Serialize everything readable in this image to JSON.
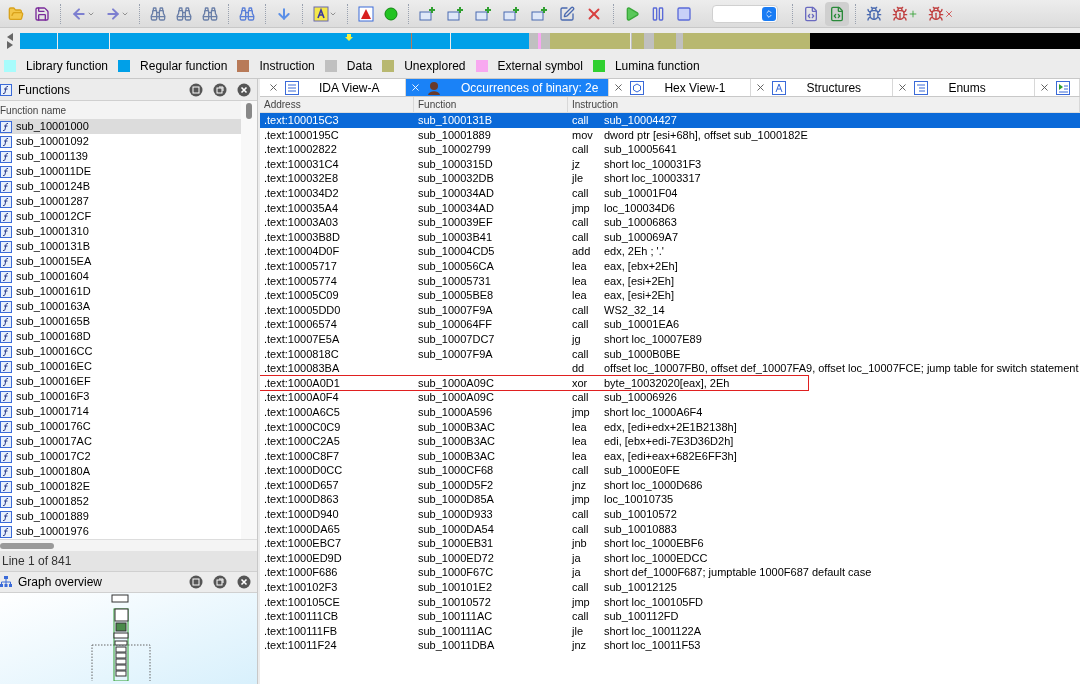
{
  "legend": [
    {
      "label": "Library function",
      "color": "#a8fcfc"
    },
    {
      "label": "Regular function",
      "color": "#00a0e8"
    },
    {
      "label": "Instruction",
      "color": "#b87a58"
    },
    {
      "label": "Data",
      "color": "#c0c0c0"
    },
    {
      "label": "Unexplored",
      "color": "#b8b870"
    },
    {
      "label": "External symbol",
      "color": "#f8a8f0"
    },
    {
      "label": "Lumina function",
      "color": "#30d030"
    }
  ],
  "functions_panel": {
    "title": "Functions",
    "column": "Function name",
    "status": "Line 1 of 841",
    "items": [
      {
        "name": "sub_10001000",
        "selected": true
      },
      {
        "name": "sub_10001092",
        "selected": false
      },
      {
        "name": "sub_10001139",
        "selected": false
      },
      {
        "name": "sub_100011DE",
        "selected": false
      },
      {
        "name": "sub_1000124B",
        "selected": false
      },
      {
        "name": "sub_10001287",
        "selected": false
      },
      {
        "name": "sub_100012CF",
        "selected": false
      },
      {
        "name": "sub_10001310",
        "selected": false
      },
      {
        "name": "sub_1000131B",
        "selected": false
      },
      {
        "name": "sub_100015EA",
        "selected": false
      },
      {
        "name": "sub_10001604",
        "selected": false
      },
      {
        "name": "sub_1000161D",
        "selected": false
      },
      {
        "name": "sub_1000163A",
        "selected": false
      },
      {
        "name": "sub_1000165B",
        "selected": false
      },
      {
        "name": "sub_1000168D",
        "selected": false
      },
      {
        "name": "sub_100016CC",
        "selected": false
      },
      {
        "name": "sub_100016EC",
        "selected": false
      },
      {
        "name": "sub_100016EF",
        "selected": false
      },
      {
        "name": "sub_100016F3",
        "selected": false
      },
      {
        "name": "sub_10001714",
        "selected": false
      },
      {
        "name": "sub_1000176C",
        "selected": false
      },
      {
        "name": "sub_100017AC",
        "selected": false
      },
      {
        "name": "sub_100017C2",
        "selected": false
      },
      {
        "name": "sub_1000180A",
        "selected": false
      },
      {
        "name": "sub_1000182E",
        "selected": false
      },
      {
        "name": "sub_10001852",
        "selected": false
      },
      {
        "name": "sub_10001889",
        "selected": false
      },
      {
        "name": "sub_10001976",
        "selected": false
      }
    ]
  },
  "graph_panel": {
    "title": "Graph overview"
  },
  "tabs": [
    {
      "label": "IDA View-A",
      "selected": false
    },
    {
      "label": "Occurrences of binary: 2e",
      "selected": true
    },
    {
      "label": "Hex View-1",
      "selected": false
    },
    {
      "label": "Structures",
      "selected": false
    },
    {
      "label": "Enums",
      "selected": false
    },
    {
      "selected": false
    }
  ],
  "table": {
    "columns": [
      "Address",
      "Function",
      "Instruction"
    ],
    "rows": [
      {
        "address": ".text:100015C3",
        "function": "sub_1000131B",
        "mnemonic": "call",
        "operands": "sub_10004427",
        "selected": true,
        "marked": false
      },
      {
        "address": ".text:1000195C",
        "function": "sub_10001889",
        "mnemonic": "mov",
        "operands": "dword ptr [esi+68h], offset sub_1000182E",
        "selected": false,
        "marked": false
      },
      {
        "address": ".text:10002822",
        "function": "sub_10002799",
        "mnemonic": "call",
        "operands": "sub_10005641",
        "selected": false,
        "marked": false
      },
      {
        "address": ".text:100031C4",
        "function": "sub_1000315D",
        "mnemonic": "jz",
        "operands": "short loc_100031F3",
        "selected": false,
        "marked": false
      },
      {
        "address": ".text:100032E8",
        "function": "sub_100032DB",
        "mnemonic": "jle",
        "operands": "short loc_10003317",
        "selected": false,
        "marked": false
      },
      {
        "address": ".text:100034D2",
        "function": "sub_100034AD",
        "mnemonic": "call",
        "operands": "sub_10001F04",
        "selected": false,
        "marked": false
      },
      {
        "address": ".text:100035A4",
        "function": "sub_100034AD",
        "mnemonic": "jmp",
        "operands": "loc_100034D6",
        "selected": false,
        "marked": false
      },
      {
        "address": ".text:10003A03",
        "function": "sub_100039EF",
        "mnemonic": "call",
        "operands": "sub_10006863",
        "selected": false,
        "marked": false
      },
      {
        "address": ".text:10003B8D",
        "function": "sub_10003B41",
        "mnemonic": "call",
        "operands": "sub_100069A7",
        "selected": false,
        "marked": false
      },
      {
        "address": ".text:10004D0F",
        "function": "sub_10004CD5",
        "mnemonic": "add",
        "operands": "edx, 2Eh ; '.'",
        "selected": false,
        "marked": false
      },
      {
        "address": ".text:10005717",
        "function": "sub_100056CA",
        "mnemonic": "lea",
        "operands": "eax, [ebx+2Eh]",
        "selected": false,
        "marked": false
      },
      {
        "address": ".text:10005774",
        "function": "sub_10005731",
        "mnemonic": "lea",
        "operands": "eax, [esi+2Eh]",
        "selected": false,
        "marked": false
      },
      {
        "address": ".text:10005C09",
        "function": "sub_10005BE8",
        "mnemonic": "lea",
        "operands": "eax, [esi+2Eh]",
        "selected": false,
        "marked": false
      },
      {
        "address": ".text:10005DD0",
        "function": "sub_10007F9A",
        "mnemonic": "call",
        "operands": "WS2_32_14",
        "selected": false,
        "marked": false
      },
      {
        "address": ".text:10006574",
        "function": "sub_100064FF",
        "mnemonic": "call",
        "operands": "sub_10001EA6",
        "selected": false,
        "marked": false
      },
      {
        "address": ".text:10007E5A",
        "function": "sub_10007DC7",
        "mnemonic": "jg",
        "operands": "short loc_10007E89",
        "selected": false,
        "marked": false
      },
      {
        "address": ".text:1000818C",
        "function": "sub_10007F9A",
        "mnemonic": "call",
        "operands": "sub_1000B0BE",
        "selected": false,
        "marked": false
      },
      {
        "address": ".text:100083BA",
        "mnemonic": "dd",
        "operands": "offset loc_10007FB0, offset def_10007FA9, offset loc_10007FCE; jump table for switch statement",
        "selected": false,
        "marked": false
      },
      {
        "address": ".text:1000A0D1",
        "function": "sub_1000A09C",
        "mnemonic": "xor",
        "operands": "byte_10032020[eax], 2Eh",
        "selected": false,
        "marked": true
      },
      {
        "address": ".text:1000A0F4",
        "function": "sub_1000A09C",
        "mnemonic": "call",
        "operands": "sub_10006926",
        "selected": false,
        "marked": false
      },
      {
        "address": ".text:1000A6C5",
        "function": "sub_1000A596",
        "mnemonic": "jmp",
        "operands": "short loc_1000A6F4",
        "selected": false,
        "marked": false
      },
      {
        "address": ".text:1000C0C9",
        "function": "sub_1000B3AC",
        "mnemonic": "lea",
        "operands": "edx, [edi+edx+2E1B2138h]",
        "selected": false,
        "marked": false
      },
      {
        "address": ".text:1000C2A5",
        "function": "sub_1000B3AC",
        "mnemonic": "lea",
        "operands": "edi, [ebx+edi-7E3D36D2h]",
        "selected": false,
        "marked": false
      },
      {
        "address": ".text:1000C8F7",
        "function": "sub_1000B3AC",
        "mnemonic": "lea",
        "operands": "eax, [edi+eax+682E6FF3h]",
        "selected": false,
        "marked": false
      },
      {
        "address": ".text:1000D0CC",
        "function": "sub_1000CF68",
        "mnemonic": "call",
        "operands": "sub_1000E0FE",
        "selected": false,
        "marked": false
      },
      {
        "address": ".text:1000D657",
        "function": "sub_1000D5F2",
        "mnemonic": "jnz",
        "operands": "short loc_1000D686",
        "selected": false,
        "marked": false
      },
      {
        "address": ".text:1000D863",
        "function": "sub_1000D85A",
        "mnemonic": "jmp",
        "operands": "loc_10010735",
        "selected": false,
        "marked": false
      },
      {
        "address": ".text:1000D940",
        "function": "sub_1000D933",
        "mnemonic": "call",
        "operands": "sub_10010572",
        "selected": false,
        "marked": false
      },
      {
        "address": ".text:1000DA65",
        "function": "sub_1000DA54",
        "mnemonic": "call",
        "operands": "sub_10010883",
        "selected": false,
        "marked": false
      },
      {
        "address": ".text:1000EBC7",
        "function": "sub_1000EB31",
        "mnemonic": "jnb",
        "operands": "short loc_1000EBF6",
        "selected": false,
        "marked": false
      },
      {
        "address": ".text:1000ED9D",
        "function": "sub_1000ED72",
        "mnemonic": "ja",
        "operands": "short loc_1000EDCC",
        "selected": false,
        "marked": false
      },
      {
        "address": ".text:1000F686",
        "function": "sub_1000F67C",
        "mnemonic": "ja",
        "operands": "short def_1000F687; jumptable 1000F687 default case",
        "selected": false,
        "marked": false
      },
      {
        "address": ".text:100102F3",
        "function": "sub_100101E2",
        "mnemonic": "call",
        "operands": "sub_10012125",
        "selected": false,
        "marked": false
      },
      {
        "address": ".text:100105CE",
        "function": "sub_10010572",
        "mnemonic": "jmp",
        "operands": "short loc_100105FD",
        "selected": false,
        "marked": false
      },
      {
        "address": ".text:100111CB",
        "function": "sub_100111AC",
        "mnemonic": "call",
        "operands": "sub_100112FD",
        "selected": false,
        "marked": false
      },
      {
        "address": ".text:100111FB",
        "function": "sub_100111AC",
        "mnemonic": "jle",
        "operands": "short loc_1001122A",
        "selected": false,
        "marked": false
      },
      {
        "address": ".text:10011F24",
        "function": "sub_10011DBA",
        "mnemonic": "jnz",
        "operands": "short loc_10011F53",
        "selected": false,
        "marked": false
      }
    ]
  }
}
